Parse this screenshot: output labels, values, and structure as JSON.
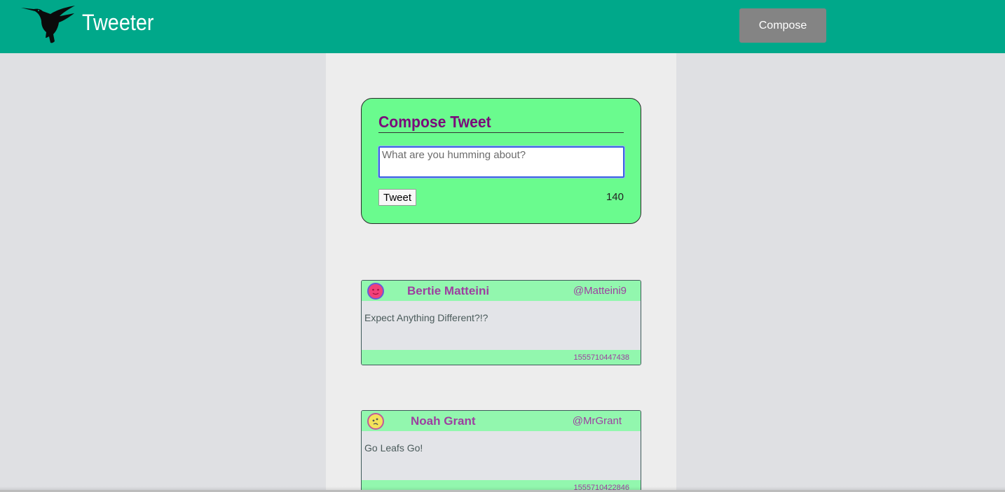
{
  "nav": {
    "brand": "Tweeter",
    "logo_icon": "hummingbird-icon",
    "compose_label": "Compose"
  },
  "new_tweet": {
    "title": "Compose Tweet",
    "placeholder": "What are you humming about?",
    "submit_label": "Tweet",
    "counter": "140"
  },
  "tweets": [
    {
      "name": "Bertie Matteini",
      "handle": "@Matteini9",
      "content": "Expect Anything Different?!?",
      "timestamp": "1555710447438",
      "avatar_icon": "pink-face-avatar-icon"
    },
    {
      "name": "Noah Grant",
      "handle": "@MrGrant",
      "content": "Go Leafs Go!",
      "timestamp": "1555710422846",
      "avatar_icon": "yellow-face-avatar-icon"
    }
  ],
  "colors": {
    "nav": "#00a88a",
    "compose_bg": "#6afb8e",
    "tweet_band": "#92f7ae",
    "accent_text": "#9d3fa0",
    "title_text": "#7a0a7a"
  }
}
